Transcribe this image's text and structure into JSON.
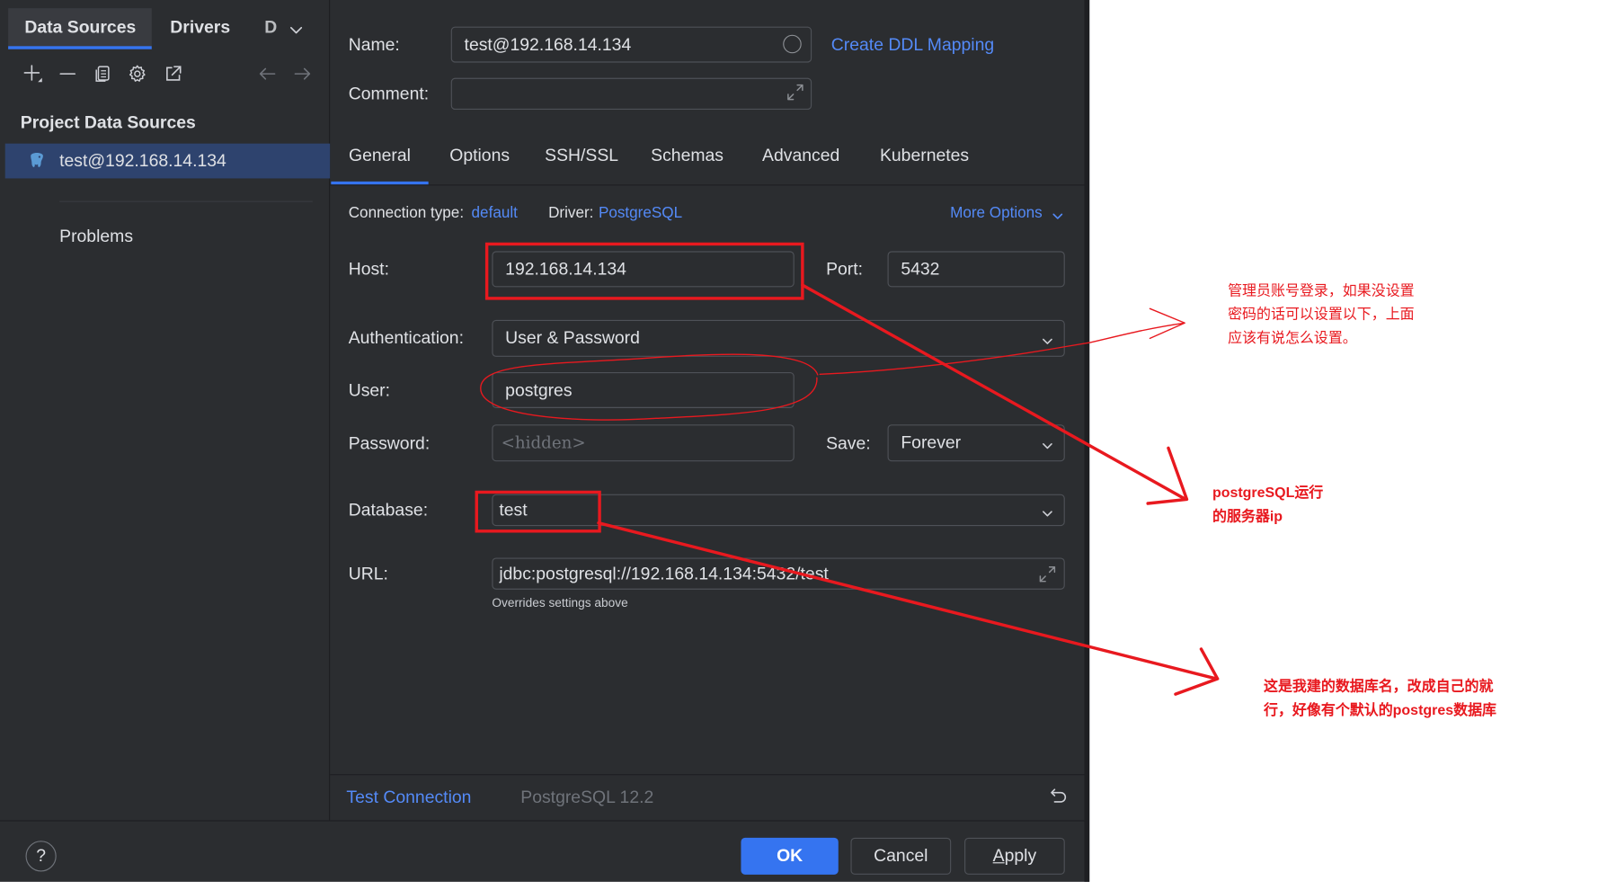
{
  "left_panel": {
    "tabs": [
      {
        "label": "Data Sources",
        "active": true
      },
      {
        "label": "Drivers",
        "active": false
      },
      {
        "label": "D",
        "active": false
      }
    ],
    "toolbar_icons": [
      "add-icon",
      "remove-icon",
      "copy-icon",
      "gear-icon",
      "export-icon",
      "back-arrow-icon",
      "forward-arrow-icon"
    ],
    "section_title": "Project Data Sources",
    "data_sources": [
      {
        "label": "test@192.168.14.134",
        "icon": "postgresql-elephant-icon",
        "selected": true
      }
    ],
    "problems_label": "Problems"
  },
  "header": {
    "name_label": "Name:",
    "name_value": "test@192.168.14.134",
    "ddl_link": "Create DDL Mapping",
    "comment_label": "Comment:",
    "comment_value": ""
  },
  "main_tabs": [
    {
      "label": "General",
      "active": true
    },
    {
      "label": "Options"
    },
    {
      "label": "SSH/SSL"
    },
    {
      "label": "Schemas"
    },
    {
      "label": "Advanced"
    },
    {
      "label": "Kubernetes"
    }
  ],
  "general": {
    "connection_type_label": "Connection type:",
    "connection_type_value": "default",
    "driver_label": "Driver:",
    "driver_value": "PostgreSQL",
    "more_options": "More Options",
    "host_label": "Host:",
    "host_value": "192.168.14.134",
    "port_label": "Port:",
    "port_value": "5432",
    "auth_label": "Authentication:",
    "auth_value": "User & Password",
    "user_label": "User:",
    "user_value": "postgres",
    "password_label": "Password:",
    "password_placeholder": "<hidden>",
    "save_label": "Save:",
    "save_value": "Forever",
    "database_label": "Database:",
    "database_value": "test",
    "url_label": "URL:",
    "url_value": "jdbc:postgresql://192.168.14.134:5432/test",
    "url_hint": "Overrides settings above"
  },
  "status_bar": {
    "test_connection": "Test Connection",
    "driver_version": "PostgreSQL 12.2"
  },
  "footer": {
    "help": "?",
    "ok": "OK",
    "cancel": "Cancel",
    "apply": "Apply"
  },
  "annotations": {
    "note_auth": [
      "管理员账号登录，如果没设置",
      "密码的话可以设置以下，上面",
      "应该有说怎么设置。"
    ],
    "note_host": [
      "postgreSQL运行",
      "的服务器ip"
    ],
    "note_database": [
      "这是我建的数据库名，改成自己的就",
      "行，好像有个默认的postgres数据库"
    ]
  },
  "colors": {
    "bg": "#2b2d30",
    "divider": "#1e1f22",
    "input_border": "#4e5157",
    "text": "#dfe1e5",
    "muted": "#6f737a",
    "link": "#548af7",
    "accent": "#3574f0",
    "selection": "#2e436e",
    "annotation": "#e8191f",
    "elephant": "#5b9bd5",
    "tab_bg": "#393b40",
    "icon": "#ced0d6"
  }
}
